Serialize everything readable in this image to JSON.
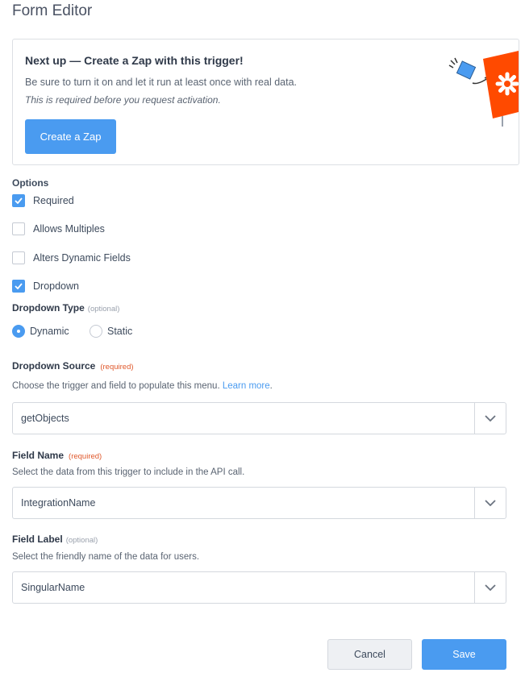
{
  "page": {
    "title": "Form Editor"
  },
  "callout": {
    "title": "Next up — Create a Zap with this trigger!",
    "line1": "Be sure to turn it on and let it run at least once with real data.",
    "line2": "This is required before you request activation.",
    "button": "Create a Zap",
    "illustration": "zapier-logo-sign-icon"
  },
  "options": {
    "label": "Options",
    "items": [
      {
        "label": "Required",
        "checked": true
      },
      {
        "label": "Allows Multiples",
        "checked": false
      },
      {
        "label": "Alters Dynamic Fields",
        "checked": false
      },
      {
        "label": "Dropdown",
        "checked": true
      }
    ]
  },
  "dropdown_type": {
    "label": "Dropdown Type",
    "tag": "(optional)",
    "choices": [
      "Dynamic",
      "Static"
    ],
    "selected": "Dynamic"
  },
  "dropdown_source": {
    "label": "Dropdown Source",
    "tag": "(required)",
    "help": "Choose the trigger and field to populate this menu.",
    "help_link": "Learn more",
    "help_suffix": ".",
    "value": "getObjects"
  },
  "field_name": {
    "label": "Field Name",
    "tag": "(required)",
    "help": "Select the data from this trigger to include in the API call.",
    "value": "IntegrationName"
  },
  "field_label": {
    "label": "Field Label",
    "tag": "(optional)",
    "help": "Select the friendly name of the data for users.",
    "value": "SingularName"
  },
  "actions": {
    "cancel": "Cancel",
    "save": "Save"
  },
  "colors": {
    "accent": "#4a9bf0",
    "required": "#e0582b",
    "brand": "#ff4a00"
  }
}
